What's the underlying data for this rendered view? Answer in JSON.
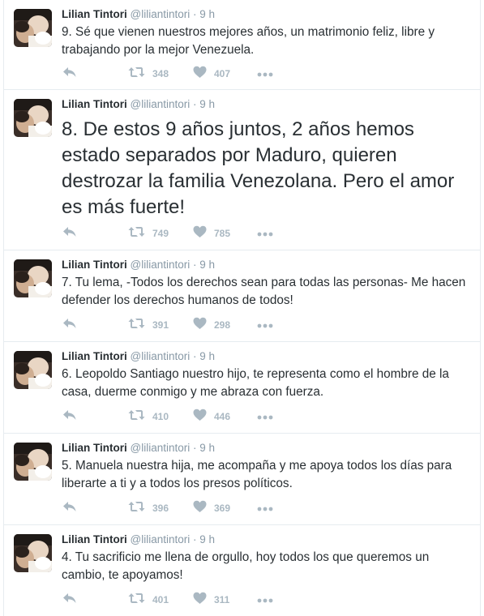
{
  "tweets": [
    {
      "fullname": "Lilian Tintori",
      "handle": "@liliantintori",
      "separator": "·",
      "time": "9 h",
      "text": "9. Sé que vienen nuestros mejores años, un matrimonio feliz, libre y trabajando por la mejor Venezuela.",
      "retweets": "348",
      "likes": "407"
    },
    {
      "fullname": "Lilian Tintori",
      "handle": "@liliantintori",
      "separator": "·",
      "time": "9 h",
      "text": "8. De estos 9 años juntos, 2 años hemos estado separados por Maduro, quieren destrozar la familia Venezolana. Pero el amor es más fuerte!",
      "retweets": "749",
      "likes": "785"
    },
    {
      "fullname": "Lilian Tintori",
      "handle": "@liliantintori",
      "separator": "·",
      "time": "9 h",
      "text": "7. Tu lema, -Todos los derechos sean para todas las personas- Me hacen defender los derechos humanos de todos!",
      "retweets": "391",
      "likes": "298"
    },
    {
      "fullname": "Lilian Tintori",
      "handle": "@liliantintori",
      "separator": "·",
      "time": "9 h",
      "text": "6. Leopoldo Santiago nuestro hijo, te representa como el hombre de la casa, duerme conmigo y me abraza con fuerza.",
      "retweets": "410",
      "likes": "446"
    },
    {
      "fullname": "Lilian Tintori",
      "handle": "@liliantintori",
      "separator": "·",
      "time": "9 h",
      "text": "5. Manuela nuestra hija, me acompaña y me apoya todos los días para liberarte a ti y a todos los presos políticos.",
      "retweets": "396",
      "likes": "369"
    },
    {
      "fullname": "Lilian Tintori",
      "handle": "@liliantintori",
      "separator": "·",
      "time": "9 h",
      "text": "4. Tu sacrificio me llena de orgullo, hoy todos los que queremos un cambio, te apoyamos!",
      "retweets": "401",
      "likes": "311"
    }
  ],
  "icons": {
    "reply": "reply-icon",
    "retweet": "retweet-icon",
    "like": "heart-icon",
    "more": "more-icon"
  },
  "colors": {
    "text": "#292f33",
    "muted": "#8899a6",
    "action": "#aab8c2",
    "divider": "#e6ecf0"
  }
}
